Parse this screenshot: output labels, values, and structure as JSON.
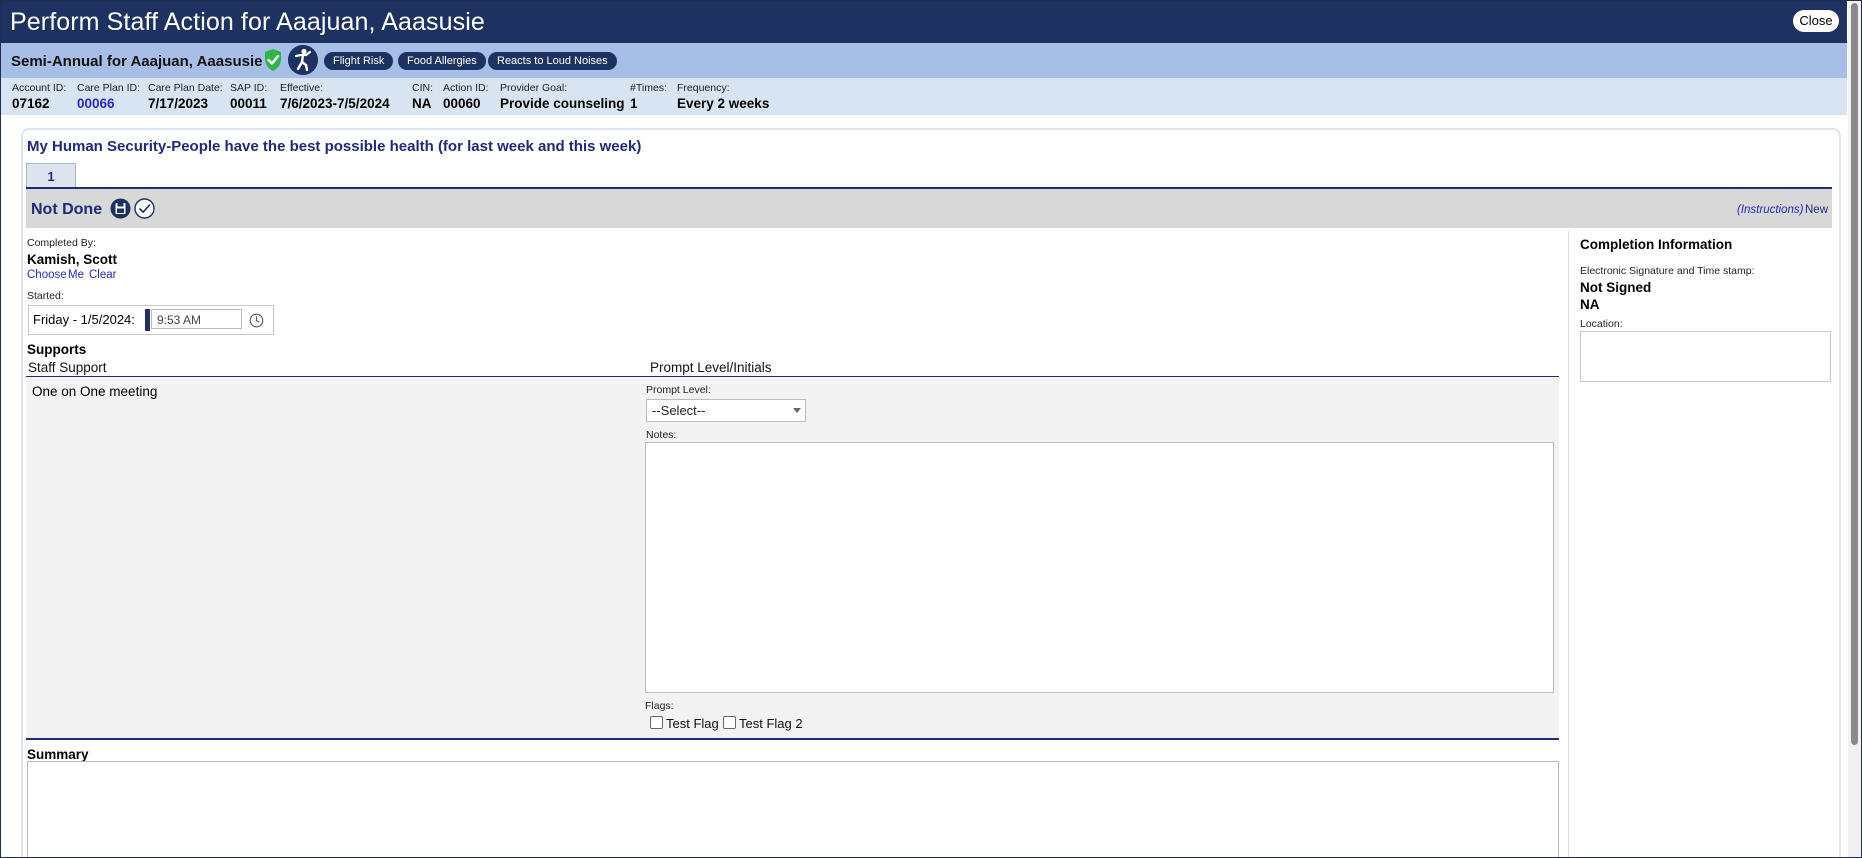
{
  "window": {
    "title": "Perform Staff Action for Aaajuan, Aaasusie",
    "close_label": "Close"
  },
  "header": {
    "plan_title": "Semi-Annual for Aaajuan, Aaasusie",
    "tags": [
      "Flight Risk",
      "Food Allergies",
      "Reacts to Loud Noises"
    ],
    "icons": [
      "shield-check-icon",
      "person-icon"
    ]
  },
  "info": [
    {
      "label": "Account ID:",
      "value": "07162",
      "link": false
    },
    {
      "label": "Care Plan ID:",
      "value": "00066",
      "link": true
    },
    {
      "label": "Care Plan Date:",
      "value": "7/17/2023",
      "link": false
    },
    {
      "label": "SAP ID:",
      "value": "00011",
      "link": false
    },
    {
      "label": "Effective:",
      "value": "7/6/2023-7/5/2024",
      "link": false
    },
    {
      "label": "CIN:",
      "value": "NA",
      "link": false
    },
    {
      "label": "Action ID:",
      "value": "00060",
      "link": false
    },
    {
      "label": "Provider Goal:",
      "value": "Provide counseling",
      "link": false
    },
    {
      "label": "#Times:",
      "value": "1",
      "link": false
    },
    {
      "label": "Frequency:",
      "value": "Every 2 weeks",
      "link": false
    }
  ],
  "goal_title": "My Human Security-People have the best possible health (for last week and this week)",
  "tabs": [
    "1"
  ],
  "status": {
    "text": "Not Done",
    "instructions_label": "(Instructions)",
    "new_label": "New"
  },
  "completed_by": {
    "label": "Completed By:",
    "name": "Kamish, Scott",
    "links": [
      "Choose",
      "Me",
      "Clear"
    ]
  },
  "started": {
    "label": "Started:",
    "date": "Friday - 1/5/2024:",
    "time": "9:53 AM"
  },
  "supports": {
    "title": "Supports",
    "col_staff": "Staff Support",
    "col_prompt": "Prompt Level/Initials",
    "staff_support_value": "One on One meeting",
    "prompt_level_label": "Prompt Level:",
    "prompt_level_selected": "--Select--",
    "notes_label": "Notes:",
    "notes_value": "",
    "flags_label": "Flags:",
    "flags": [
      {
        "label": "Test Flag",
        "checked": false
      },
      {
        "label": "Test Flag 2",
        "checked": false
      }
    ]
  },
  "summary": {
    "title": "Summary",
    "value": ""
  },
  "completion": {
    "title": "Completion Information",
    "signature_label": "Electronic Signature and Time stamp:",
    "signature_status": "Not Signed",
    "signature_value": "NA",
    "location_label": "Location:",
    "location_value": ""
  },
  "colors": {
    "title_bar": "#1e3262",
    "subheader": "#a7bfe6",
    "info_row": "#d9e4f2",
    "accent": "#1e2a7a",
    "link": "#2a2ab8",
    "shield_green": "#2fb34a"
  }
}
